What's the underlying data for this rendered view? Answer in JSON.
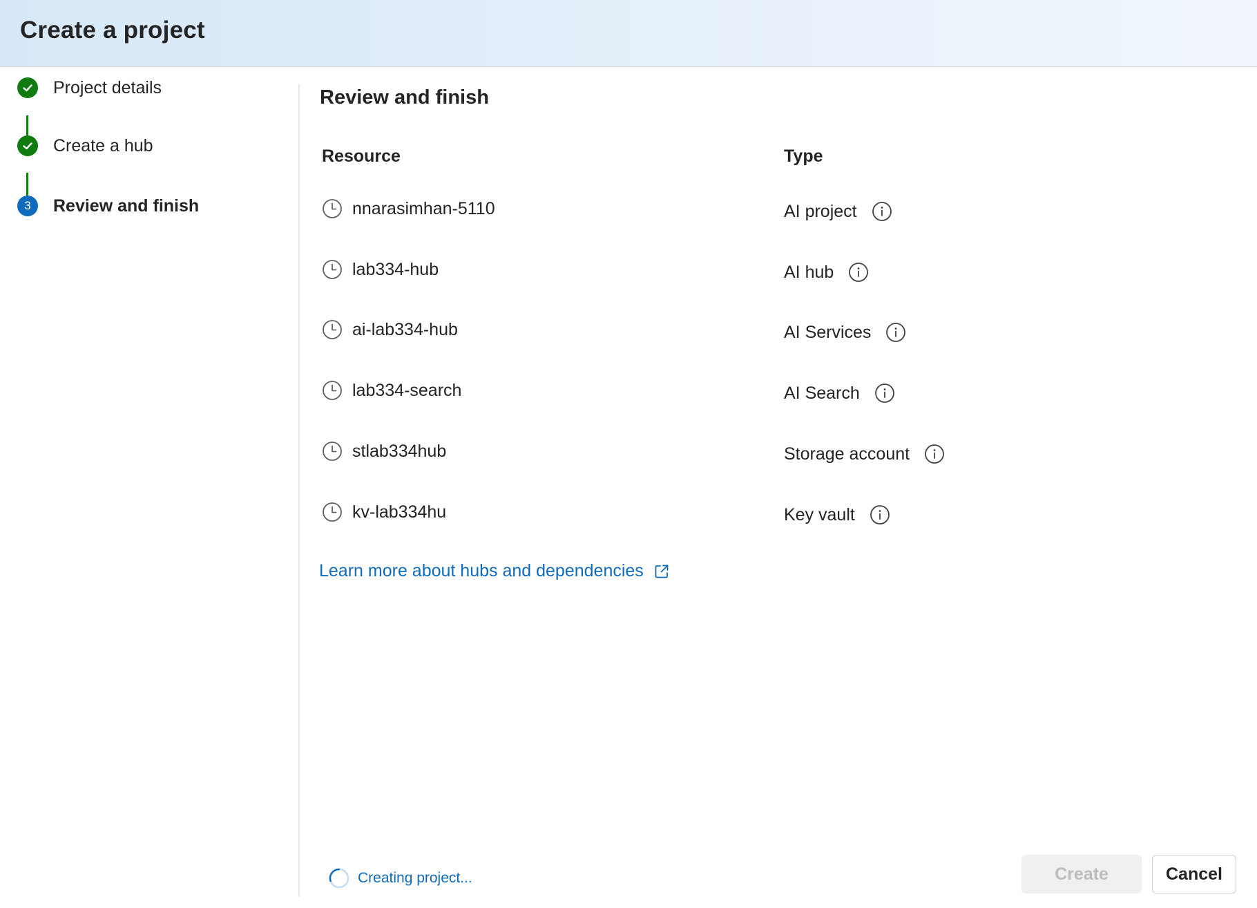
{
  "dialog": {
    "title": "Create a project"
  },
  "stepper": {
    "steps": [
      {
        "label": "Project details",
        "status": "completed",
        "icon": "checkmark-icon"
      },
      {
        "label": "Create a hub",
        "status": "completed",
        "icon": "checkmark-icon"
      },
      {
        "label": "Review and finish",
        "status": "current",
        "number": "3"
      }
    ]
  },
  "main": {
    "title": "Review and finish",
    "table": {
      "headers": {
        "resource": "Resource",
        "type": "Type"
      },
      "rows": [
        {
          "resource": "nnarasimhan-5110",
          "type": "AI project",
          "status_icon": "clock-icon",
          "info_icon": "info-icon"
        },
        {
          "resource": "lab334-hub",
          "type": "AI hub",
          "status_icon": "clock-icon",
          "info_icon": "info-icon"
        },
        {
          "resource": "ai-lab334-hub",
          "type": "AI Services",
          "status_icon": "clock-icon",
          "info_icon": "info-icon"
        },
        {
          "resource": "lab334-search",
          "type": "AI Search",
          "status_icon": "clock-icon",
          "info_icon": "info-icon"
        },
        {
          "resource": "stlab334hub",
          "type": "Storage account",
          "status_icon": "clock-icon",
          "info_icon": "info-icon"
        },
        {
          "resource": "kv-lab334hu",
          "type": "Key vault",
          "status_icon": "clock-icon",
          "info_icon": "info-icon"
        }
      ]
    },
    "learn_more_link": "Learn more about hubs and dependencies"
  },
  "footer": {
    "status_text": "Creating project...",
    "create_label": "Create",
    "cancel_label": "Cancel"
  },
  "colors": {
    "success": "#107c10",
    "brand": "#0f6cbd",
    "header_gradient_start": "#d6e8f7",
    "disabled_bg": "#f0f0f0"
  }
}
